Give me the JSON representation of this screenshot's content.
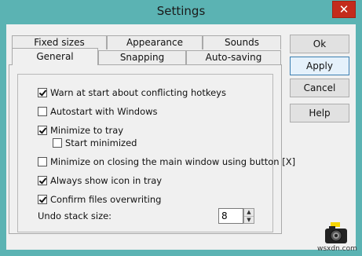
{
  "window": {
    "title": "Settings",
    "close_glyph": "✕"
  },
  "tabs": {
    "row1": [
      "Fixed sizes",
      "Appearance",
      "Sounds"
    ],
    "row2": [
      "General",
      "Snapping",
      "Auto-saving"
    ],
    "active": "General"
  },
  "options": [
    {
      "label": "Warn at start about conflicting hotkeys",
      "checked": true
    },
    {
      "label": "Autostart with Windows",
      "checked": false
    },
    {
      "label": "Minimize to tray",
      "checked": true
    },
    {
      "label": "Start minimized",
      "checked": false
    },
    {
      "label": "Minimize on closing the main window using button [X]",
      "checked": false
    },
    {
      "label": "Always show icon in tray",
      "checked": true
    },
    {
      "label": "Confirm files overwriting",
      "checked": true
    }
  ],
  "undo": {
    "label": "Undo stack size:",
    "value": "8"
  },
  "buttons": {
    "ok": "Ok",
    "apply": "Apply",
    "cancel": "Cancel",
    "help": "Help"
  },
  "watermark": "wsxdn.com",
  "icons": {
    "close": "close-icon",
    "camera": "camera-icon",
    "spin_up": "chevron-up-icon",
    "spin_down": "chevron-down-icon"
  },
  "colors": {
    "title_bg": "#5bb3b3",
    "close_bg": "#c42b1c",
    "client_bg": "#f0f0f0"
  }
}
